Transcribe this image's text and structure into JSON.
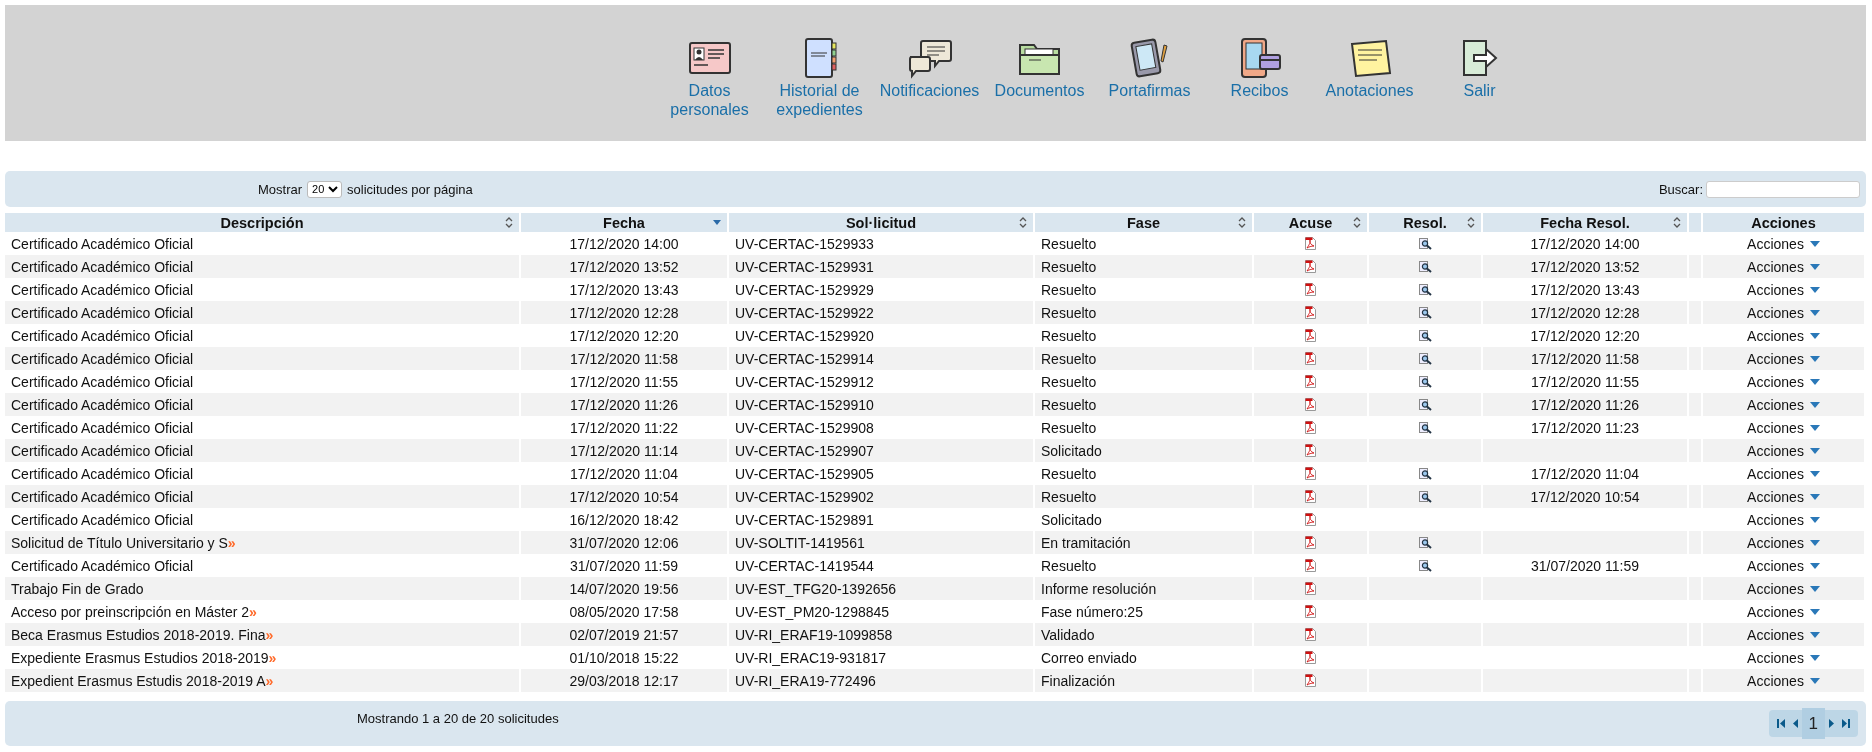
{
  "nav": [
    {
      "kind": "id-card",
      "label": "Datos personales"
    },
    {
      "kind": "notebook",
      "label": "Historial de expedientes"
    },
    {
      "kind": "chat",
      "label": "Notificaciones"
    },
    {
      "kind": "folder",
      "label": "Documentos"
    },
    {
      "kind": "tablet",
      "label": "Portafirmas"
    },
    {
      "kind": "receipt",
      "label": "Recibos"
    },
    {
      "kind": "note",
      "label": "Anotaciones"
    },
    {
      "kind": "exit",
      "label": "Salir"
    }
  ],
  "toolbar": {
    "show_label": "Mostrar",
    "page_size": "20",
    "show_suffix": "solicitudes por página",
    "search_label": "Buscar:"
  },
  "table": {
    "columns": [
      {
        "label": "Descripción",
        "sortable": true,
        "sorted": false
      },
      {
        "label": "Fecha",
        "sortable": true,
        "sorted": true
      },
      {
        "label": "Sol·licitud",
        "sortable": true,
        "sorted": false
      },
      {
        "label": "Fase",
        "sortable": true,
        "sorted": false
      },
      {
        "label": "Acuse",
        "sortable": true,
        "sorted": false
      },
      {
        "label": "Resol.",
        "sortable": true,
        "sorted": false
      },
      {
        "label": "Fecha Resol.",
        "sortable": true,
        "sorted": false
      },
      {
        "label": "Acciones",
        "sortable": false,
        "sorted": false
      }
    ],
    "rows": [
      {
        "description": "Certificado Académico Oficial",
        "date": "17/12/2020 14:00",
        "request": "UV-CERTAC-1529933",
        "phase": "Resuelto",
        "resolution": true,
        "resolution_date": "17/12/2020 14:00",
        "actions": "Acciones"
      },
      {
        "description": "Certificado Académico Oficial",
        "date": "17/12/2020 13:52",
        "request": "UV-CERTAC-1529931",
        "phase": "Resuelto",
        "resolution": true,
        "resolution_date": "17/12/2020 13:52",
        "actions": "Acciones"
      },
      {
        "description": "Certificado Académico Oficial",
        "date": "17/12/2020 13:43",
        "request": "UV-CERTAC-1529929",
        "phase": "Resuelto",
        "resolution": true,
        "resolution_date": "17/12/2020 13:43",
        "actions": "Acciones"
      },
      {
        "description": "Certificado Académico Oficial",
        "date": "17/12/2020 12:28",
        "request": "UV-CERTAC-1529922",
        "phase": "Resuelto",
        "resolution": true,
        "resolution_date": "17/12/2020 12:28",
        "actions": "Acciones"
      },
      {
        "description": "Certificado Académico Oficial",
        "date": "17/12/2020 12:20",
        "request": "UV-CERTAC-1529920",
        "phase": "Resuelto",
        "resolution": true,
        "resolution_date": "17/12/2020 12:20",
        "actions": "Acciones"
      },
      {
        "description": "Certificado Académico Oficial",
        "date": "17/12/2020 11:58",
        "request": "UV-CERTAC-1529914",
        "phase": "Resuelto",
        "resolution": true,
        "resolution_date": "17/12/2020 11:58",
        "actions": "Acciones"
      },
      {
        "description": "Certificado Académico Oficial",
        "date": "17/12/2020 11:55",
        "request": "UV-CERTAC-1529912",
        "phase": "Resuelto",
        "resolution": true,
        "resolution_date": "17/12/2020 11:55",
        "actions": "Acciones"
      },
      {
        "description": "Certificado Académico Oficial",
        "date": "17/12/2020 11:26",
        "request": "UV-CERTAC-1529910",
        "phase": "Resuelto",
        "resolution": true,
        "resolution_date": "17/12/2020 11:26",
        "actions": "Acciones"
      },
      {
        "description": "Certificado Académico Oficial",
        "date": "17/12/2020 11:22",
        "request": "UV-CERTAC-1529908",
        "phase": "Resuelto",
        "resolution": true,
        "resolution_date": "17/12/2020 11:23",
        "actions": "Acciones"
      },
      {
        "description": "Certificado Académico Oficial",
        "date": "17/12/2020 11:14",
        "request": "UV-CERTAC-1529907",
        "phase": "Solicitado",
        "resolution": false,
        "actions": "Acciones"
      },
      {
        "description": "Certificado Académico Oficial",
        "date": "17/12/2020 11:04",
        "request": "UV-CERTAC-1529905",
        "phase": "Resuelto",
        "resolution": true,
        "resolution_date": "17/12/2020 11:04",
        "actions": "Acciones"
      },
      {
        "description": "Certificado Académico Oficial",
        "date": "17/12/2020 10:54",
        "request": "UV-CERTAC-1529902",
        "phase": "Resuelto",
        "resolution": true,
        "resolution_date": "17/12/2020 10:54",
        "actions": "Acciones"
      },
      {
        "description": "Certificado Académico Oficial",
        "date": "16/12/2020 18:42",
        "request": "UV-CERTAC-1529891",
        "phase": "Solicitado",
        "resolution": false,
        "actions": "Acciones"
      },
      {
        "description": "Solicitud de Título Universitario y S»",
        "truncated": true,
        "date": "31/07/2020 12:06",
        "request": "UV-SOLTIT-1419561",
        "phase": "En tramitación",
        "resolution": true,
        "actions": "Acciones"
      },
      {
        "description": "Certificado Académico Oficial",
        "date": "31/07/2020 11:59",
        "request": "UV-CERTAC-1419544",
        "phase": "Resuelto",
        "resolution": true,
        "resolution_date": "31/07/2020 11:59",
        "actions": "Acciones"
      },
      {
        "description": "Trabajo Fin de Grado",
        "date": "14/07/2020 19:56",
        "request": "UV-EST_TFG20-1392656",
        "phase": "Informe resolución",
        "resolution": false,
        "actions": "Acciones"
      },
      {
        "description": "Acceso por preinscripción en Máster 2»",
        "truncated": true,
        "date": "08/05/2020 17:58",
        "request": "UV-EST_PM20-1298845",
        "phase": "Fase número:25",
        "resolution": false,
        "actions": "Acciones"
      },
      {
        "description": "Beca Erasmus Estudios 2018-2019. Fina»",
        "truncated": true,
        "date": "02/07/2019 21:57",
        "request": "UV-RI_ERAF19-1099858",
        "phase": "Validado",
        "resolution": false,
        "actions": "Acciones"
      },
      {
        "description": "Expediente Erasmus Estudios 2018-2019»",
        "truncated": true,
        "date": "01/10/2018 15:22",
        "request": "UV-RI_ERAC19-931817",
        "phase": "Correo enviado",
        "resolution": false,
        "actions": "Acciones"
      },
      {
        "description": "Expedient Erasmus Estudis 2018-2019 A»",
        "truncated": true,
        "date": "29/03/2018 12:17",
        "request": "UV-RI_ERA19-772496",
        "phase": "Finalización",
        "resolution": false,
        "actions": "Acciones"
      }
    ]
  },
  "footer": {
    "info": "Mostrando 1 a 20 de 20 solicitudes",
    "page": "1"
  }
}
